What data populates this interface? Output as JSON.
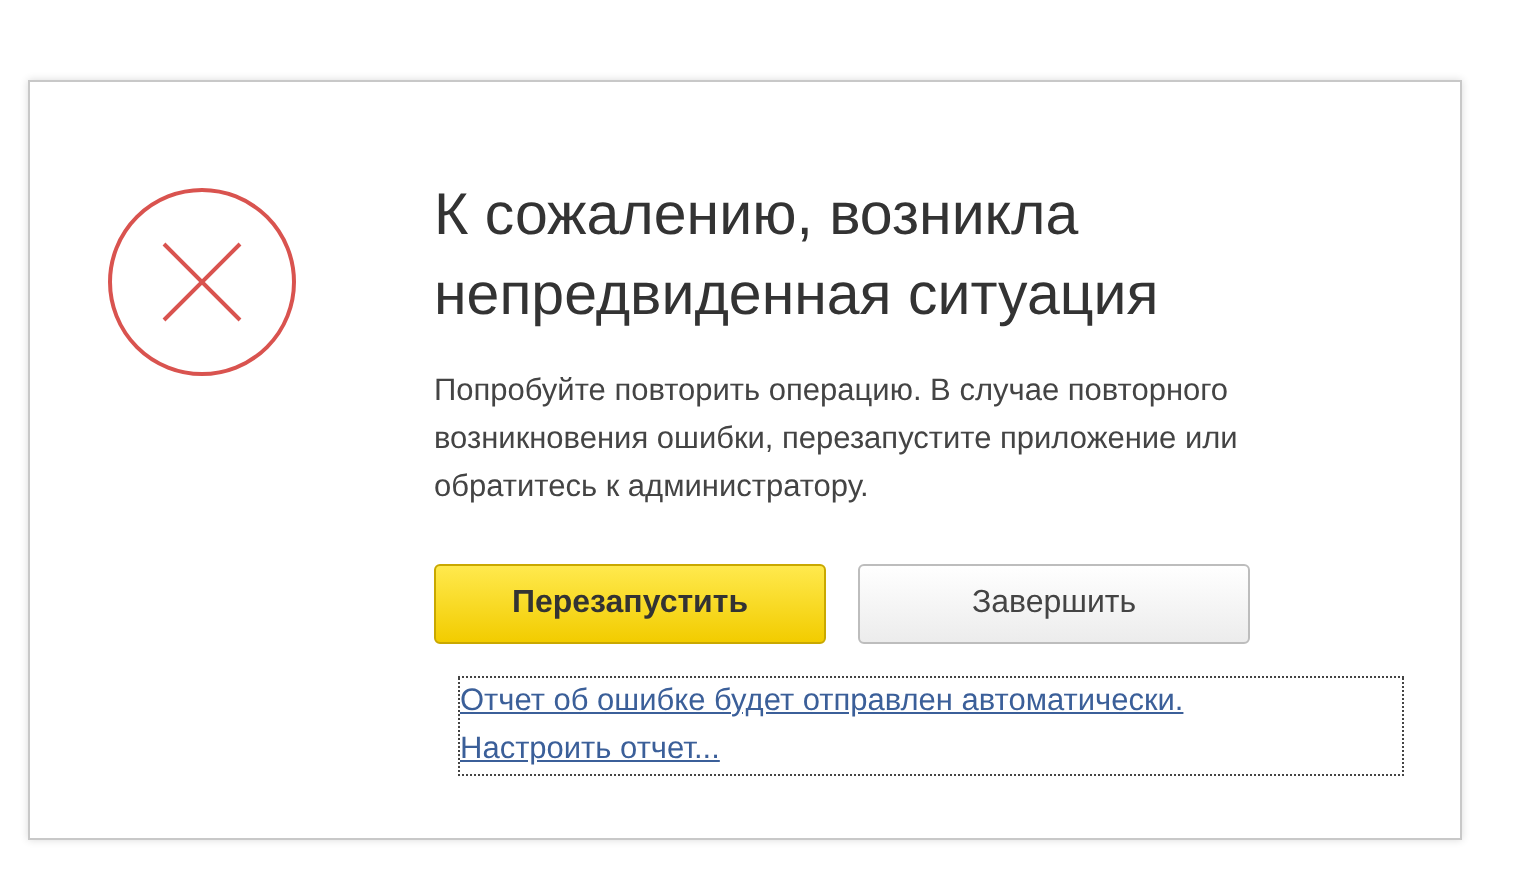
{
  "dialog": {
    "title_lines": [
      "К сожалению, возникла",
      "непредвиденная ситуация"
    ],
    "message_lines": [
      "Попробуйте повторить операцию. В случае повторного",
      "возникновения ошибки, перезапустите приложение или",
      "обратитесь к администратору."
    ],
    "buttons": [
      {
        "label": "Перезапустить",
        "kind": "primary"
      },
      {
        "label": "Завершить",
        "kind": "secondary"
      }
    ],
    "links": [
      "Отчет об ошибке будет отправлен автоматически.",
      "Настроить отчет..."
    ]
  }
}
